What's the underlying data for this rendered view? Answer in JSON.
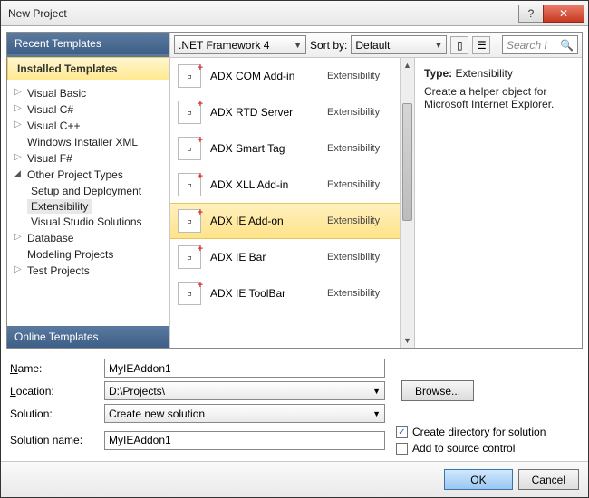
{
  "window": {
    "title": "New Project"
  },
  "sidebar": {
    "recent": "Recent Templates",
    "installed": "Installed Templates",
    "online": "Online Templates",
    "tree": [
      {
        "label": "Visual Basic",
        "expandable": true
      },
      {
        "label": "Visual C#",
        "expandable": true
      },
      {
        "label": "Visual C++",
        "expandable": true
      },
      {
        "label": "Windows Installer XML",
        "expandable": false
      },
      {
        "label": "Visual F#",
        "expandable": true
      },
      {
        "label": "Other Project Types",
        "expandable": true,
        "expanded": true,
        "children": [
          {
            "label": "Setup and Deployment",
            "expandable": true
          },
          {
            "label": "Extensibility",
            "selected": true
          },
          {
            "label": "Visual Studio Solutions"
          }
        ]
      },
      {
        "label": "Database",
        "expandable": true
      },
      {
        "label": "Modeling Projects",
        "expandable": false
      },
      {
        "label": "Test Projects",
        "expandable": true
      }
    ]
  },
  "toolbar": {
    "framework": ".NET Framework 4",
    "sortby_label": "Sort by:",
    "sortby_value": "Default",
    "search_placeholder": "Search I"
  },
  "templates": [
    {
      "name": "ADX COM Add-in",
      "category": "Extensibility"
    },
    {
      "name": "ADX RTD Server",
      "category": "Extensibility"
    },
    {
      "name": "ADX Smart Tag",
      "category": "Extensibility"
    },
    {
      "name": "ADX XLL Add-in",
      "category": "Extensibility"
    },
    {
      "name": "ADX IE Add-on",
      "category": "Extensibility",
      "selected": true
    },
    {
      "name": "ADX IE Bar",
      "category": "Extensibility"
    },
    {
      "name": "ADX IE ToolBar",
      "category": "Extensibility"
    }
  ],
  "details": {
    "type_label": "Type:",
    "type_value": "Extensibility",
    "description": "Create a helper object for Microsoft Internet Explorer."
  },
  "form": {
    "name_label": "Name:",
    "name_value": "MyIEAddon1",
    "location_label": "Location:",
    "location_value": "D:\\Projects\\",
    "browse_label": "Browse...",
    "solution_label": "Solution:",
    "solution_value": "Create new solution",
    "solname_label": "Solution name:",
    "solname_value": "MyIEAddon1",
    "chk_createdir": "Create directory for solution",
    "chk_createdir_checked": true,
    "chk_source": "Add to source control",
    "chk_source_checked": false
  },
  "buttons": {
    "ok": "OK",
    "cancel": "Cancel"
  }
}
